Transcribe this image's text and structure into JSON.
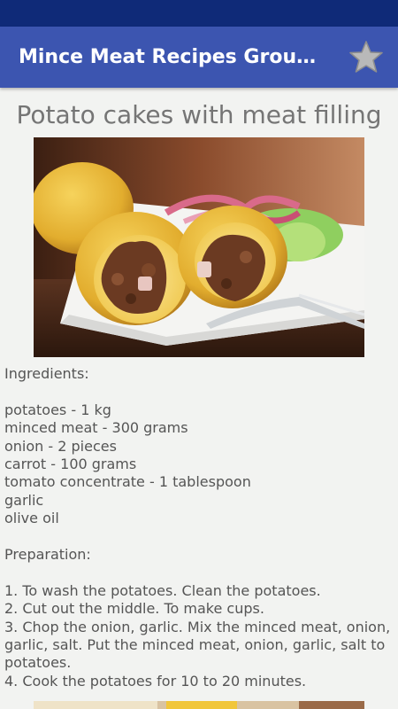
{
  "app": {
    "title": "Mince Meat Recipes Ground Beef Recipes",
    "favorite_icon": "star-icon",
    "colors": {
      "status_bar": "#0f2a78",
      "app_bar": "#3c55b0",
      "background": "#f2f3f1"
    }
  },
  "recipe": {
    "title": "Potato cakes with meat filling",
    "ingredients_heading": "Ingredients:",
    "ingredients": [
      "potatoes - 1 kg",
      "minced meat - 300 grams",
      "onion - 2 pieces",
      "carrot - 100 grams",
      "tomato concentrate - 1 tablespoon",
      "garlic",
      "olive oil"
    ],
    "preparation_heading": "Preparation:",
    "steps": [
      "1. To wash the potatoes. Clean the potatoes.",
      "2. Cut out the middle. To make cups.",
      "3. Chop the onion, garlic. Mix the minced meat, onion, garlic, salt. Put the minced meat, onion, garlic, salt to potatoes.",
      "4. Cook the potatoes for 10 to 20 minutes."
    ]
  }
}
